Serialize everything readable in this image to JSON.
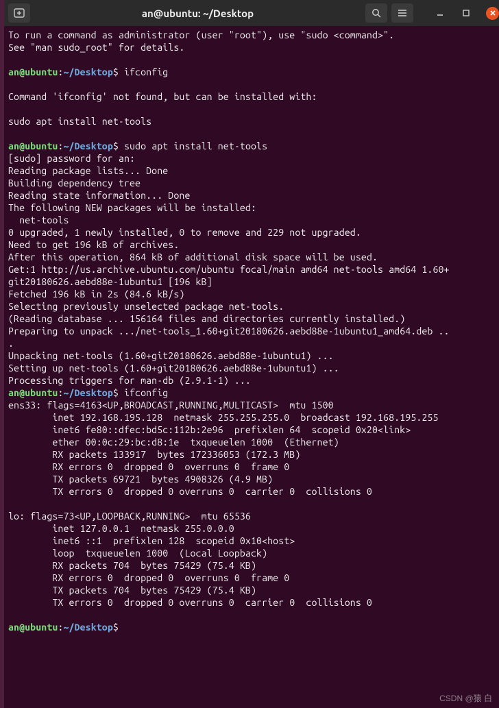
{
  "titlebar": {
    "title": "an@ubuntu: ~/Desktop",
    "new_tab_icon": "new-tab-icon",
    "search_icon": "search-icon",
    "menu_icon": "hamburger-icon",
    "minimize_icon": "minimize-icon",
    "maximize_icon": "maximize-icon",
    "close_icon": "close-icon"
  },
  "prompt": {
    "user": "an",
    "at": "@",
    "host": "ubuntu",
    "colon": ":",
    "path": "~/Desktop",
    "dollar": "$"
  },
  "cmd1": " ifconfig",
  "cmd2": " sudo apt install net-tools",
  "cmd3": " ifconfig",
  "cmd4": " ",
  "intro": {
    "l1": "To run a command as administrator (user \"root\"), use \"sudo <command>\".",
    "l2": "See \"man sudo_root\" for details."
  },
  "notfound": {
    "l1": "Command 'ifconfig' not found, but can be installed with:",
    "l2": "sudo apt install net-tools"
  },
  "apt": {
    "l1": "[sudo] password for an: ",
    "l2": "Reading package lists... Done",
    "l3": "Building dependency tree       ",
    "l4": "Reading state information... Done",
    "l5": "The following NEW packages will be installed:",
    "l6": "  net-tools",
    "l7": "0 upgraded, 1 newly installed, 0 to remove and 229 not upgraded.",
    "l8": "Need to get 196 kB of archives.",
    "l9": "After this operation, 864 kB of additional disk space will be used.",
    "l10": "Get:1 http://us.archive.ubuntu.com/ubuntu focal/main amd64 net-tools amd64 1.60+",
    "l11": "git20180626.aebd88e-1ubuntu1 [196 kB]",
    "l12": "Fetched 196 kB in 2s (84.6 kB/s)",
    "l13": "Selecting previously unselected package net-tools.",
    "l14": "(Reading database ... 156164 files and directories currently installed.)",
    "l15": "Preparing to unpack .../net-tools_1.60+git20180626.aebd88e-1ubuntu1_amd64.deb ..",
    "l16": ".",
    "l17": "Unpacking net-tools (1.60+git20180626.aebd88e-1ubuntu1) ...",
    "l18": "Setting up net-tools (1.60+git20180626.aebd88e-1ubuntu1) ...",
    "l19": "Processing triggers for man-db (2.9.1-1) ..."
  },
  "ifconfig": {
    "l1": "ens33: flags=4163<UP,BROADCAST,RUNNING,MULTICAST>  mtu 1500",
    "l2": "        inet 192.168.195.128  netmask 255.255.255.0  broadcast 192.168.195.255",
    "l3": "        inet6 fe80::dfec:bd5c:112b:2e96  prefixlen 64  scopeid 0x20<link>",
    "l4": "        ether 00:0c:29:bc:d8:1e  txqueuelen 1000  (Ethernet)",
    "l5": "        RX packets 133917  bytes 172336053 (172.3 MB)",
    "l6": "        RX errors 0  dropped 0  overruns 0  frame 0",
    "l7": "        TX packets 69721  bytes 4908326 (4.9 MB)",
    "l8": "        TX errors 0  dropped 0 overruns 0  carrier 0  collisions 0",
    "l9": "",
    "l10": "lo: flags=73<UP,LOOPBACK,RUNNING>  mtu 65536",
    "l11": "        inet 127.0.0.1  netmask 255.0.0.0",
    "l12": "        inet6 ::1  prefixlen 128  scopeid 0x10<host>",
    "l13": "        loop  txqueuelen 1000  (Local Loopback)",
    "l14": "        RX packets 704  bytes 75429 (75.4 KB)",
    "l15": "        RX errors 0  dropped 0  overruns 0  frame 0",
    "l16": "        TX packets 704  bytes 75429 (75.4 KB)",
    "l17": "        TX errors 0  dropped 0 overruns 0  carrier 0  collisions 0"
  },
  "watermark": "CSDN @猿 白"
}
